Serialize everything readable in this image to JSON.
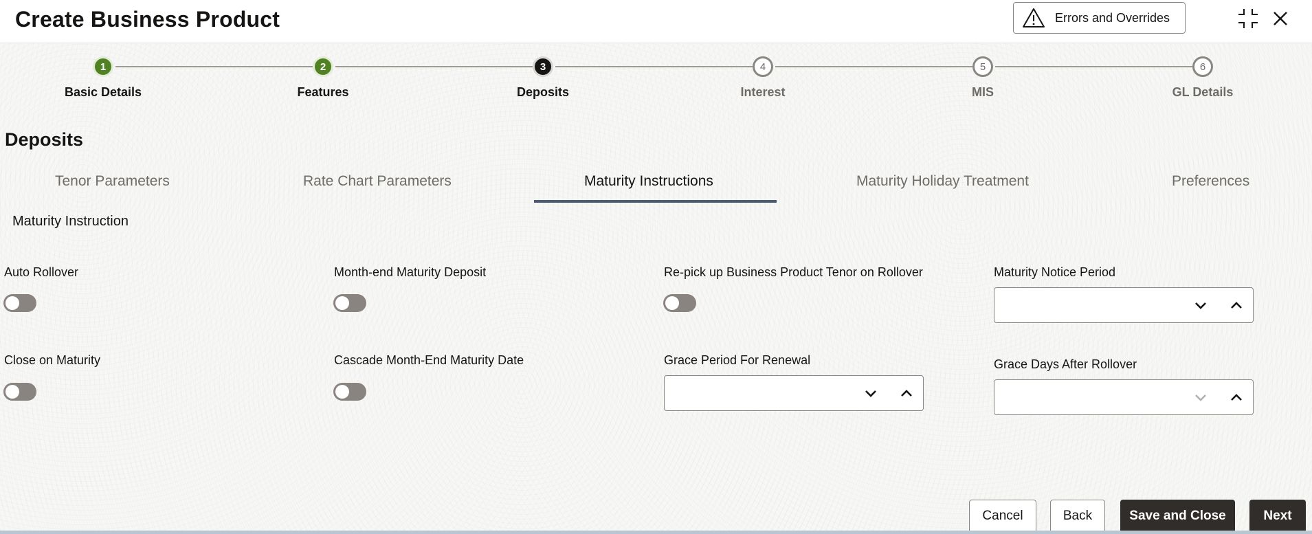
{
  "header": {
    "title": "Create Business Product",
    "errors_button": "Errors and Overrides",
    "icons": [
      "warning-icon",
      "minimize-icon",
      "close-icon"
    ]
  },
  "stepper": {
    "steps": [
      {
        "number": "1",
        "label": "Basic Details",
        "state": "done"
      },
      {
        "number": "2",
        "label": "Features",
        "state": "done"
      },
      {
        "number": "3",
        "label": "Deposits",
        "state": "current"
      },
      {
        "number": "4",
        "label": "Interest",
        "state": "todo"
      },
      {
        "number": "5",
        "label": "MIS",
        "state": "todo"
      },
      {
        "number": "6",
        "label": "GL Details",
        "state": "todo"
      }
    ]
  },
  "section_title": "Deposits",
  "tabs": [
    {
      "label": "Tenor Parameters",
      "active": false
    },
    {
      "label": "Rate Chart Parameters",
      "active": false
    },
    {
      "label": "Maturity Instructions",
      "active": true
    },
    {
      "label": "Maturity Holiday Treatment",
      "active": false
    },
    {
      "label": "Preferences",
      "active": false
    }
  ],
  "subsection": "Maturity Instruction",
  "fields": {
    "auto_rollover": {
      "label": "Auto Rollover",
      "value": false
    },
    "month_end_maturity_deposit": {
      "label": "Month-end Maturity Deposit",
      "value": false
    },
    "repick_tenor": {
      "label": "Re-pick up Business Product Tenor on Rollover",
      "value": false
    },
    "maturity_notice_period": {
      "label": "Maturity Notice Period",
      "value": ""
    },
    "close_on_maturity": {
      "label": "Close on Maturity",
      "value": false
    },
    "cascade_month_end": {
      "label": "Cascade Month-End Maturity Date",
      "value": false
    },
    "grace_period_renewal": {
      "label": "Grace Period For Renewal",
      "value": ""
    },
    "grace_days_after_rollover": {
      "label": "Grace Days After Rollover",
      "value": ""
    }
  },
  "footer": {
    "cancel": "Cancel",
    "back": "Back",
    "save_close": "Save and Close",
    "next": "Next"
  },
  "colors": {
    "step_done": "#508223",
    "step_current": "#161513",
    "tab_underline": "#4c5a74",
    "primary_button": "#312d2a",
    "toggle_off": "#8a8480"
  }
}
